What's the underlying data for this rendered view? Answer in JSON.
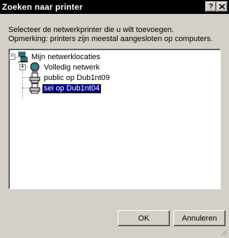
{
  "window": {
    "title": "Zoeken naar printer",
    "help_button": "?",
    "close_button": "×"
  },
  "instructions": {
    "line1": "Selecteer de netwerkprinter die u wilt toevoegen.",
    "line2": "Opmerking: printers zijn meestal aangesloten op computers."
  },
  "tree": {
    "root": {
      "label": "Mijn netwerklocaties",
      "expanded": true,
      "icon": "network-places-icon"
    },
    "children": [
      {
        "label": "Volledig netwerk",
        "expanded": false,
        "icon": "globe-icon"
      },
      {
        "label": "public op Dub1nt09",
        "icon": "printer-icon",
        "selected": false
      },
      {
        "label": "sei op Dub1nt04",
        "icon": "printer-icon",
        "selected": true
      }
    ]
  },
  "buttons": {
    "ok": "OK",
    "cancel": "Annuleren"
  },
  "colors": {
    "face": "#d4d0c8",
    "titlebar": "#000000",
    "selection": "#000080"
  }
}
